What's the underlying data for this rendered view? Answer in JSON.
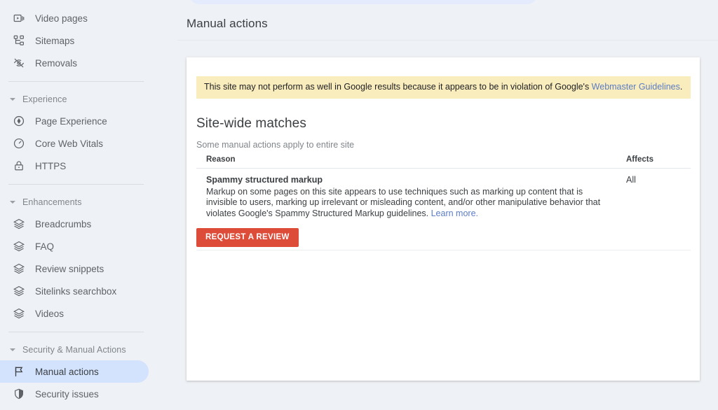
{
  "sidebar": {
    "groups": [
      {
        "name": "top-items",
        "items": [
          {
            "label": "Video pages",
            "icon": "video-pages-icon",
            "selected": false
          },
          {
            "label": "Sitemaps",
            "icon": "sitemaps-icon",
            "selected": false
          },
          {
            "label": "Removals",
            "icon": "removals-icon",
            "selected": false
          }
        ]
      },
      {
        "name": "experience",
        "header": "Experience",
        "items": [
          {
            "label": "Page Experience",
            "icon": "page-experience-icon",
            "selected": false
          },
          {
            "label": "Core Web Vitals",
            "icon": "core-web-vitals-icon",
            "selected": false
          },
          {
            "label": "HTTPS",
            "icon": "https-lock-icon",
            "selected": false
          }
        ]
      },
      {
        "name": "enhancements",
        "header": "Enhancements",
        "items": [
          {
            "label": "Breadcrumbs",
            "icon": "layers-icon",
            "selected": false
          },
          {
            "label": "FAQ",
            "icon": "layers-icon",
            "selected": false
          },
          {
            "label": "Review snippets",
            "icon": "layers-icon",
            "selected": false
          },
          {
            "label": "Sitelinks searchbox",
            "icon": "layers-icon",
            "selected": false
          },
          {
            "label": "Videos",
            "icon": "layers-icon",
            "selected": false
          }
        ]
      },
      {
        "name": "security-manual-actions",
        "header": "Security & Manual Actions",
        "items": [
          {
            "label": "Manual actions",
            "icon": "flag-icon",
            "selected": true
          },
          {
            "label": "Security issues",
            "icon": "shield-icon",
            "selected": false
          }
        ]
      }
    ]
  },
  "header": {
    "title": "Manual actions"
  },
  "card": {
    "alert": {
      "text_before": "This site may not perform as well in Google results because it appears to be in violation of Google's ",
      "link_label": "Webmaster Guidelines",
      "text_after": "."
    },
    "section_title": "Site-wide matches",
    "note": "Some manual actions apply to entire site",
    "table": {
      "columns": [
        "Reason",
        "Affects"
      ],
      "rows": [
        {
          "reason_name": "Spammy structured markup",
          "reason_description": "Markup on some pages on this site appears to use techniques such as marking up content that is invisible to users, marking up irrelevant or misleading content, and/or other manipulative behavior that violates Google's Spammy Structured Markup guidelines. ",
          "reason_link": "Learn more.",
          "affects": "All"
        }
      ]
    },
    "request_review_label": "REQUEST A REVIEW"
  },
  "colors": {
    "page_background": "#eef1f5",
    "selected_nav": "#d3e2fd",
    "alert_background": "#faedbd",
    "link": "#5b7cc4",
    "button_red": "#dd4b39",
    "card_background": "#ffffff"
  }
}
